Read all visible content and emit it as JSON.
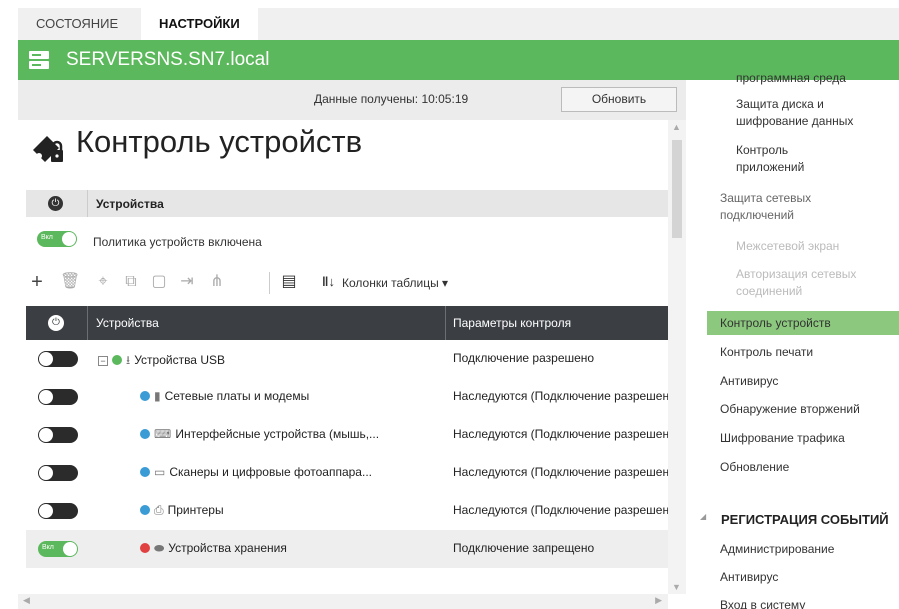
{
  "tabs": [
    {
      "label": "СОСТОЯНИЕ"
    },
    {
      "label": "НАСТРОЙКИ"
    }
  ],
  "server": {
    "name": "SERVERSNS.SN7.local"
  },
  "status": {
    "data_label": "Данные получены:",
    "time": "10:05:19",
    "refresh_label": "Обновить"
  },
  "page": {
    "title": "Контроль устройств"
  },
  "section": {
    "title": "Устройства"
  },
  "policy": {
    "label": "Политика устройств включена",
    "toggle_text": "Вкл",
    "enabled": true
  },
  "toolbar": {
    "columns_label": "Колонки таблицы ▾"
  },
  "table": {
    "headers": {
      "devices": "Устройства",
      "params": "Параметры контроля"
    },
    "rows": [
      {
        "name": "Устройства USB",
        "param": "Подключение разрешено",
        "enabled": false,
        "status": "green",
        "icon": "usb-icon"
      },
      {
        "name": "Сетевые платы и модемы",
        "param": "Наследуются (Подключение разрешено)",
        "enabled": false,
        "status": "inherit",
        "icon": "network-card-icon"
      },
      {
        "name": "Интерфейсные устройства (мышь,...",
        "param": "Наследуются (Подключение разрешено)",
        "enabled": false,
        "status": "inherit",
        "icon": "keyboard-icon"
      },
      {
        "name": "Сканеры и цифровые фотоаппара...",
        "param": "Наследуются (Подключение разрешено)",
        "enabled": false,
        "status": "inherit",
        "icon": "scanner-icon"
      },
      {
        "name": "Принтеры",
        "param": "Наследуются (Подключение разрешено)",
        "enabled": false,
        "status": "inherit",
        "icon": "printer-icon"
      },
      {
        "name": "Устройства хранения",
        "param": "Подключение запрещено",
        "enabled": true,
        "status": "red",
        "icon": "storage-icon",
        "toggle_text": "Вкл"
      }
    ]
  },
  "rightnav": {
    "items": [
      {
        "label": "программная среда"
      },
      {
        "label": "Защита диска и шифрование данных"
      },
      {
        "label": "Контроль приложений"
      },
      {
        "label": "Защита сетевых подключений"
      },
      {
        "label": "Межсетевой экран"
      },
      {
        "label": "Авторизация сетевых соединений"
      },
      {
        "label": "Контроль устройств"
      },
      {
        "label": "Контроль печати"
      },
      {
        "label": "Антивирус"
      },
      {
        "label": "Обнаружение вторжений"
      },
      {
        "label": "Шифрование трафика"
      },
      {
        "label": "Обновление"
      }
    ],
    "section2": "РЕГИСТРАЦИЯ СОБЫТИЙ",
    "section2_items": [
      {
        "label": "Администрирование"
      },
      {
        "label": "Антивирус"
      },
      {
        "label": "Вход в систему"
      }
    ]
  },
  "colors": {
    "accent_green": "#5cb85c",
    "active_nav": "#8cc97e",
    "table_header": "#3b3f44",
    "status_red": "#e04040"
  }
}
